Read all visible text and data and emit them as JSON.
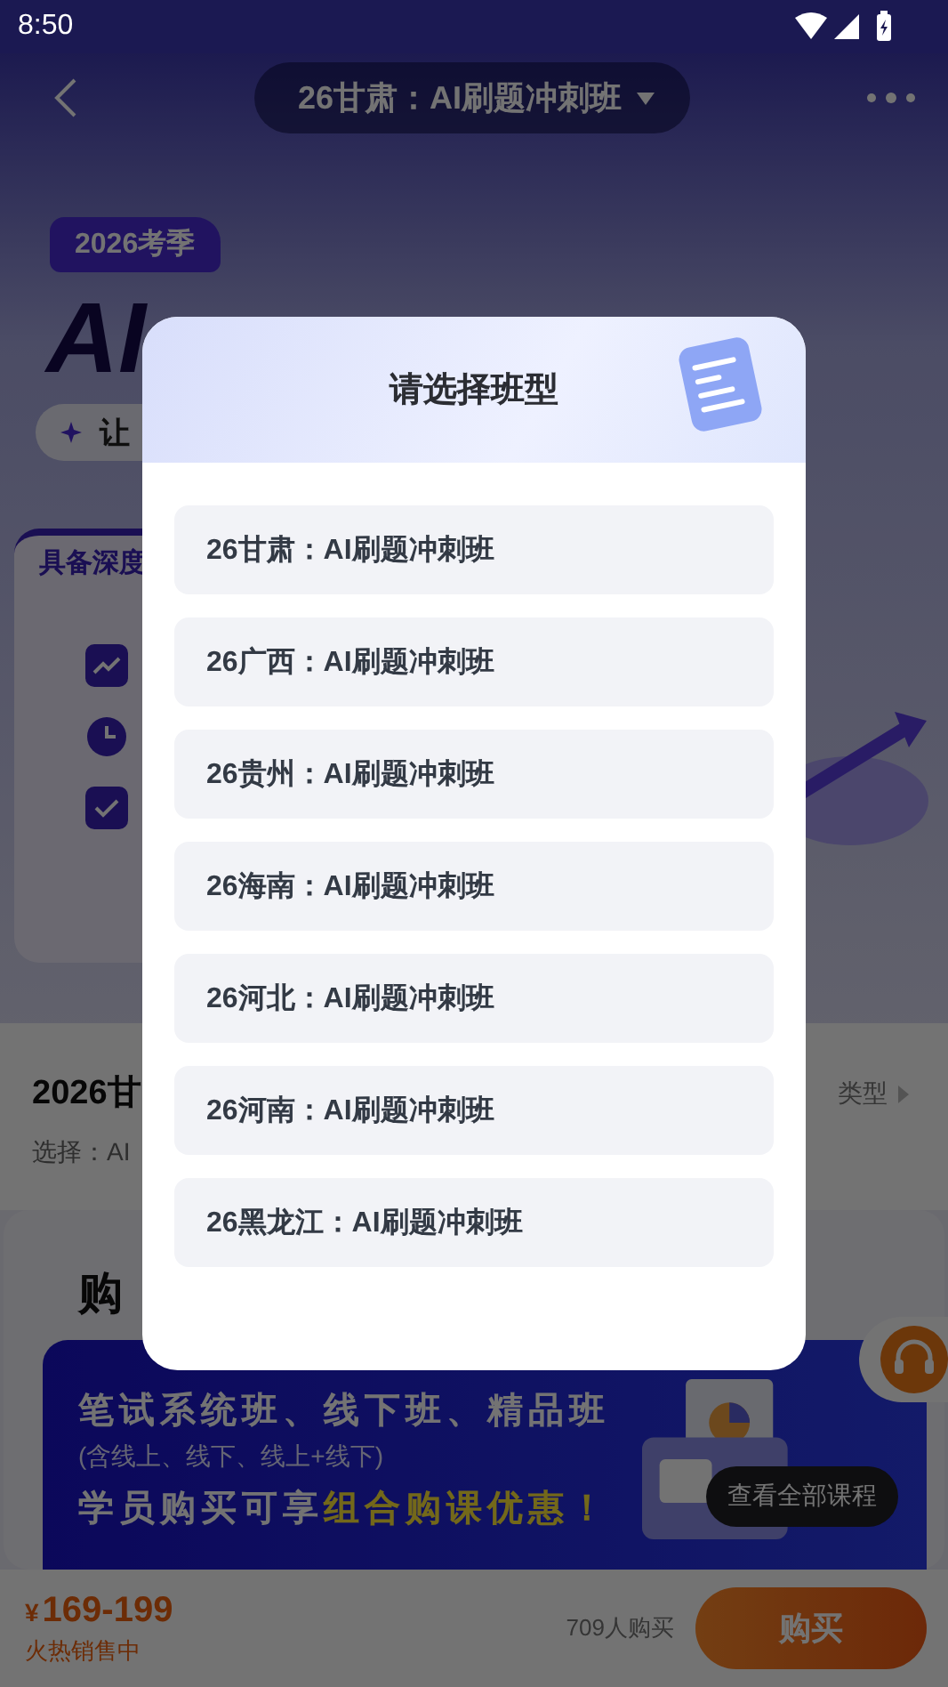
{
  "status_bar": {
    "time": "8:50"
  },
  "nav": {
    "title": "26甘肃：AI刷题冲刺班"
  },
  "hero": {
    "season_badge": "2026考季",
    "headline": "AI",
    "tagline": "让",
    "feature_card_title": "具备深度"
  },
  "course": {
    "title": "2026甘",
    "selection": "选择：AI",
    "type_label": "类型"
  },
  "promo": {
    "heading": "购",
    "line_1": "笔试系统班、线下班、精品班",
    "line_2": "(含线上、线下、线上+线下)",
    "line_3_prefix": "学员购买可享",
    "line_3_highlight": "组合购课优惠！"
  },
  "tooltip": "查看全部课程",
  "bottom_bar": {
    "price_symbol": "¥",
    "price": "169-199",
    "status": "火热销售中",
    "buyers": "709人购买",
    "buy_button": "购买"
  },
  "dialog": {
    "title": "请选择班型",
    "options": [
      {
        "label": "26甘肃：AI刷题冲刺班"
      },
      {
        "label": "26广西：AI刷题冲刺班"
      },
      {
        "label": "26贵州：AI刷题冲刺班"
      },
      {
        "label": "26海南：AI刷题冲刺班"
      },
      {
        "label": "26河北：AI刷题冲刺班"
      },
      {
        "label": "26河南：AI刷题冲刺班"
      },
      {
        "label": "26黑龙江：AI刷题冲刺班"
      }
    ]
  }
}
